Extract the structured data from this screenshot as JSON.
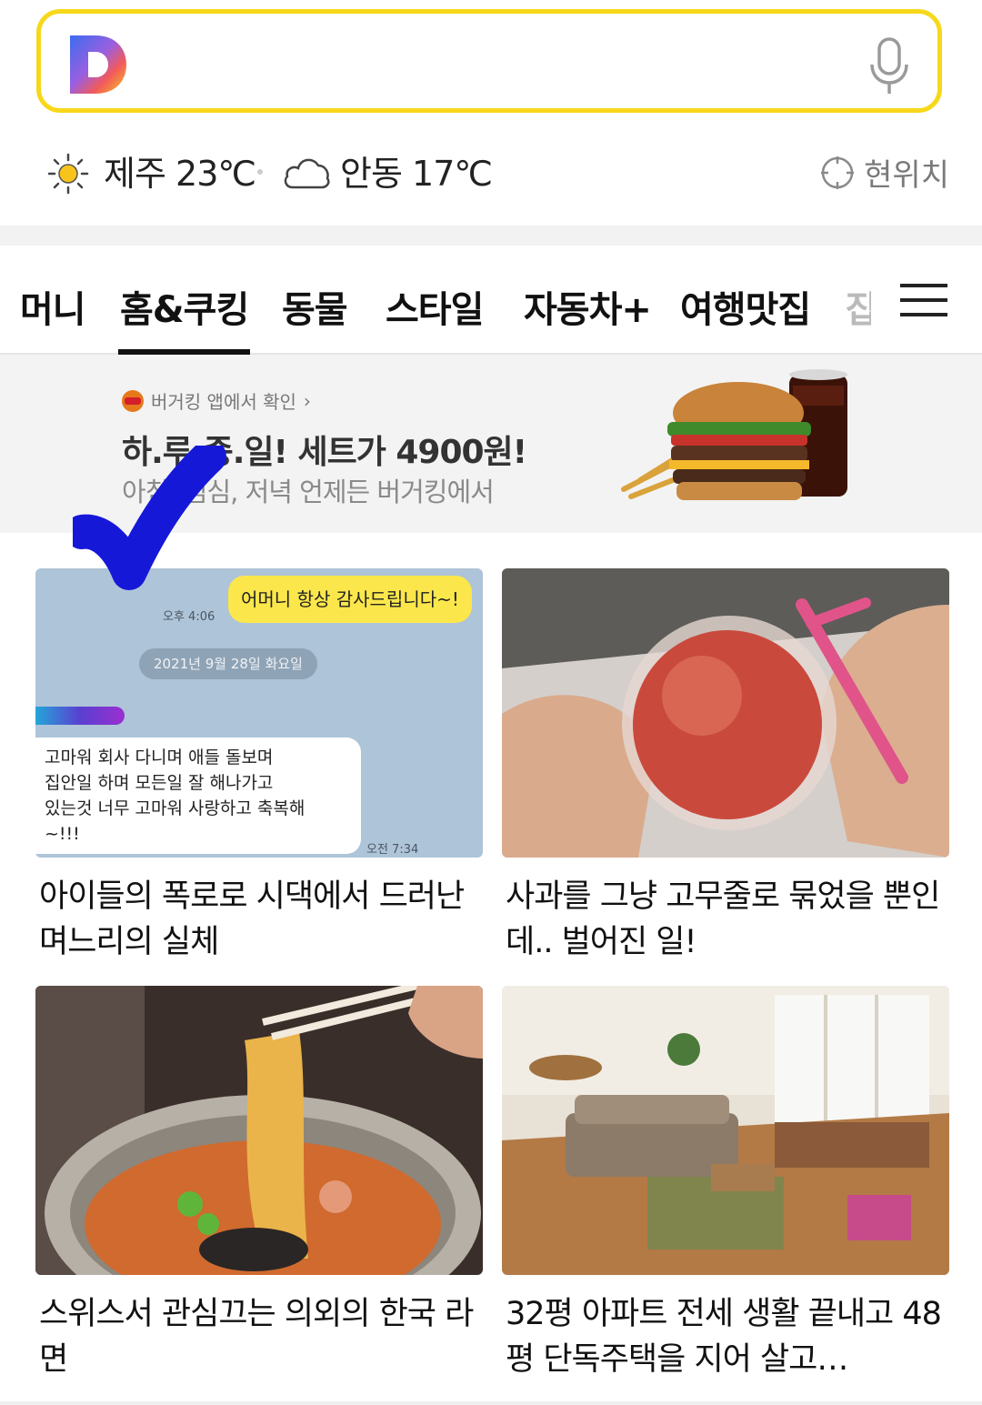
{
  "search": {
    "placeholder": ""
  },
  "weather": [
    {
      "city": "제주",
      "temp": "23℃",
      "icon": "sun-icon"
    },
    {
      "city": "안동",
      "temp": "17℃",
      "icon": "cloud-icon"
    }
  ],
  "location_label": "현위치",
  "tabs": [
    "머니",
    "홈&쿠킹",
    "동물",
    "스타일",
    "자동차+",
    "여행맛집",
    "잡"
  ],
  "active_tab": "홈&쿠킹",
  "ad": {
    "source": "버거킹 앱에서 확인",
    "title": "하.루.종.일! 세트가 4900원!",
    "subtitle": "아침, 점심, 저녁 언제든 버거킹에서"
  },
  "cards": [
    {
      "title": "아이들의 폭로로 시댁에서 드러난 며느리의 실체",
      "thumb": {
        "yellow_msg": "어머니 항상 감사드립니다~!",
        "time1": "오후 4:06",
        "date": "2021년 9월 28일 화요일",
        "white_msg": "고마워 회사 다니며 애들 돌보며\n집안일 하며 모든일 잘 해나가고\n있는것 너무 고마워 사랑하고 축복해\n~!!!",
        "time2": "오전 7:34"
      }
    },
    {
      "title": "사과를 그냥 고무줄로 묶었을 뿐인데.. 벌어진 일!"
    },
    {
      "title": "스위스서 관심끄는 의외의 한국 라면"
    },
    {
      "title": "32평 아파트 전세 생활 끝내고 48평 단독주택을 지어 살고…"
    }
  ],
  "colors": {
    "search_border": "#f7d81a",
    "chat_bg": "#aec4d8",
    "bubble_yellow": "#fbe74b"
  }
}
